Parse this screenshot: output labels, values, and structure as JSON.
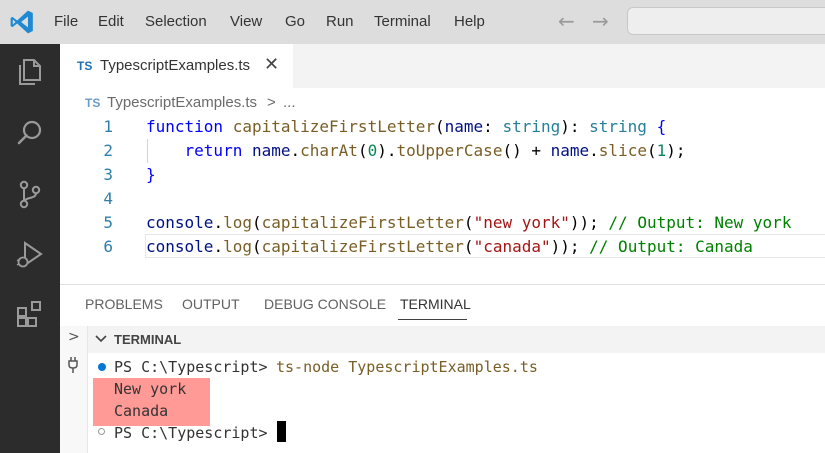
{
  "menu": [
    "File",
    "Edit",
    "Selection",
    "View",
    "Go",
    "Run",
    "Terminal",
    "Help"
  ],
  "tab": {
    "lang_badge": "TS",
    "filename": "TypescriptExamples.ts"
  },
  "breadcrumb": {
    "lang_badge": "TS",
    "filename": "TypescriptExamples.ts",
    "separator": ">",
    "ellipsis": "..."
  },
  "editor": {
    "line_numbers": [
      "1",
      "2",
      "3",
      "4",
      "5",
      "6"
    ],
    "lines": [
      [
        {
          "t": "function",
          "c": "kw"
        },
        {
          "t": " ",
          "c": "pn"
        },
        {
          "t": "capitalizeFirstLetter",
          "c": "fn"
        },
        {
          "t": "(",
          "c": "pn"
        },
        {
          "t": "name",
          "c": "vr"
        },
        {
          "t": ": ",
          "c": "pn"
        },
        {
          "t": "string",
          "c": "ty"
        },
        {
          "t": "): ",
          "c": "pn"
        },
        {
          "t": "string",
          "c": "ty"
        },
        {
          "t": " {",
          "c": "kw"
        }
      ],
      [
        {
          "t": "    ",
          "c": "pn"
        },
        {
          "t": "return",
          "c": "kw"
        },
        {
          "t": " ",
          "c": "pn"
        },
        {
          "t": "name",
          "c": "vr"
        },
        {
          "t": ".",
          "c": "pn"
        },
        {
          "t": "charAt",
          "c": "fn"
        },
        {
          "t": "(",
          "c": "pn"
        },
        {
          "t": "0",
          "c": "nm"
        },
        {
          "t": ").",
          "c": "pn"
        },
        {
          "t": "toUpperCase",
          "c": "fn"
        },
        {
          "t": "() + ",
          "c": "pn"
        },
        {
          "t": "name",
          "c": "vr"
        },
        {
          "t": ".",
          "c": "pn"
        },
        {
          "t": "slice",
          "c": "fn"
        },
        {
          "t": "(",
          "c": "pn"
        },
        {
          "t": "1",
          "c": "nm"
        },
        {
          "t": ");",
          "c": "pn"
        }
      ],
      [
        {
          "t": "}",
          "c": "kw"
        }
      ],
      [],
      [
        {
          "t": "console",
          "c": "vr"
        },
        {
          "t": ".",
          "c": "pn"
        },
        {
          "t": "log",
          "c": "fn"
        },
        {
          "t": "(",
          "c": "pn"
        },
        {
          "t": "capitalizeFirstLetter",
          "c": "fn"
        },
        {
          "t": "(",
          "c": "pn"
        },
        {
          "t": "\"new york\"",
          "c": "st"
        },
        {
          "t": ")); ",
          "c": "pn"
        },
        {
          "t": "// Output: New york",
          "c": "cm"
        }
      ],
      [
        {
          "t": "console",
          "c": "vr"
        },
        {
          "t": ".",
          "c": "pn"
        },
        {
          "t": "log",
          "c": "fn"
        },
        {
          "t": "(",
          "c": "pn"
        },
        {
          "t": "capitalizeFirstLetter",
          "c": "fn"
        },
        {
          "t": "(",
          "c": "pn"
        },
        {
          "t": "\"canada\"",
          "c": "st"
        },
        {
          "t": ")); ",
          "c": "pn"
        },
        {
          "t": "// Output: Canada",
          "c": "cm"
        }
      ]
    ]
  },
  "panel": {
    "tabs": [
      "PROBLEMS",
      "OUTPUT",
      "DEBUG CONSOLE",
      "TERMINAL"
    ],
    "active_tab": "TERMINAL",
    "section_title": "TERMINAL"
  },
  "terminal": {
    "prompt": "PS C:\\Typescript>",
    "command": "ts-node TypescriptExamples.ts",
    "output": [
      "New york",
      "Canada"
    ],
    "prompt2": "PS C:\\Typescript>"
  },
  "colors": {
    "accent": "#0078d4",
    "highlight": "#ff9a96",
    "activity_bar": "#2c2c2c"
  }
}
